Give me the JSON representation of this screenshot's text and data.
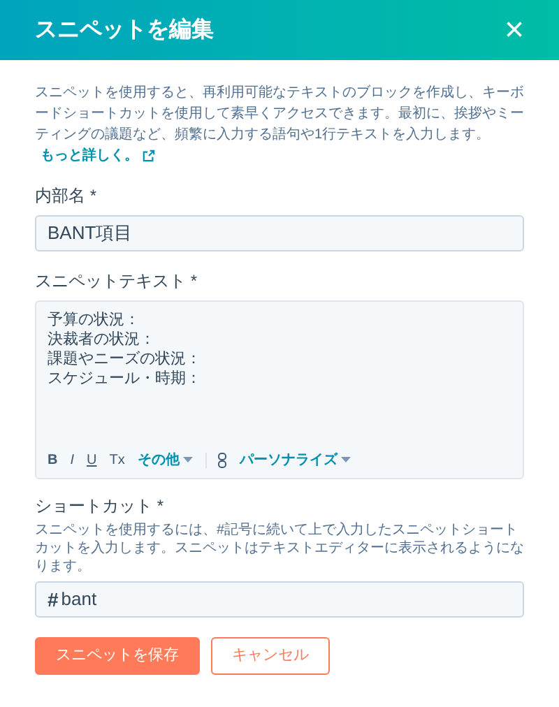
{
  "header": {
    "title": "スニペットを編集",
    "close": "×"
  },
  "description": {
    "text": "スニペットを使用すると、再利用可能なテキストのブロックを作成し、キーボードショートカットを使用して素早くアクセスできます。最初に、挨拶やミーティングの議題など、頻繁に入力する語句や1行テキストを入力します。",
    "link": "もっと詳しく。"
  },
  "name_field": {
    "label": "内部名",
    "required_mark": "*",
    "value": "BANT項目"
  },
  "text_field": {
    "label": "スニペットテキスト",
    "required_mark": "*",
    "lines": [
      "予算の状況：",
      "決裁者の状況：",
      "課題やニーズの状況：",
      "スケジュール・時期："
    ],
    "toolbar": [
      {
        "kind": "format",
        "label": "B"
      },
      {
        "kind": "format",
        "label": "I"
      },
      {
        "kind": "format",
        "label": "U"
      },
      {
        "kind": "format",
        "label": "Tx"
      },
      {
        "kind": "dropdown",
        "label": "その他"
      },
      {
        "kind": "link"
      },
      {
        "kind": "dropdown",
        "label": "パーソナライズ"
      }
    ]
  },
  "shortcut_field": {
    "label": "ショートカット",
    "required_mark": "*",
    "hint": "スニペットを使用するには、#記号に続いて上で入力したスニペットショートカットを入力します。スニペットはテキストエディターに表示されるようになります。",
    "prefix": "#",
    "value": "bant"
  },
  "buttons": [
    {
      "kind": "primary",
      "label": "スニペットを保存"
    },
    {
      "kind": "secondary",
      "label": "キャンセル"
    }
  ]
}
